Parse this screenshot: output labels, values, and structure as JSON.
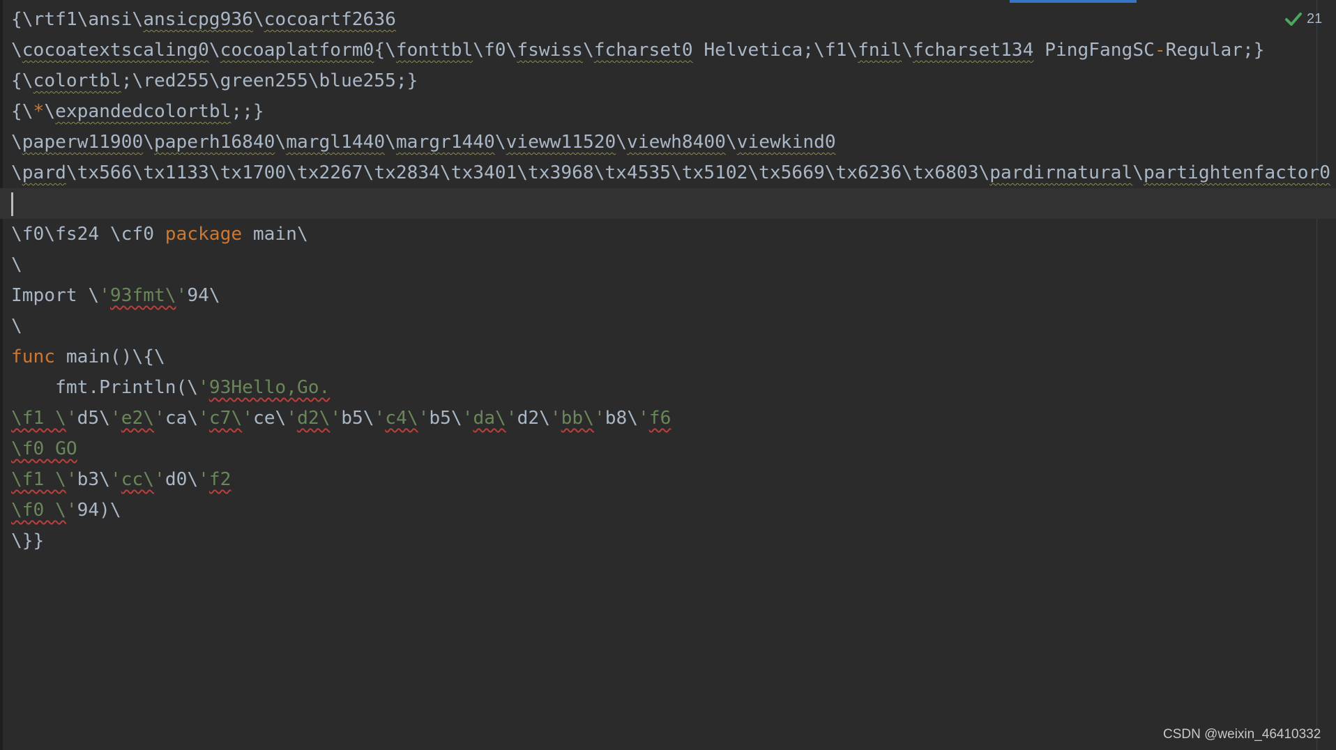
{
  "inspection": {
    "icon": "check-icon",
    "count": "21"
  },
  "editor": {
    "caret_line": 6,
    "lines": [
      {
        "tokens": [
          {
            "t": "{\\rtf1\\ansi\\",
            "c": "default"
          },
          {
            "t": "ansicpg936",
            "c": "default",
            "u": "typo"
          },
          {
            "t": "\\",
            "c": "default"
          },
          {
            "t": "cocoartf2636",
            "c": "default",
            "u": "typo"
          }
        ]
      },
      {
        "tokens": [
          {
            "t": "\\",
            "c": "default"
          },
          {
            "t": "cocoatextscaling0",
            "c": "default",
            "u": "typo"
          },
          {
            "t": "\\",
            "c": "default"
          },
          {
            "t": "cocoaplatform0",
            "c": "default",
            "u": "typo"
          },
          {
            "t": "{\\",
            "c": "default"
          },
          {
            "t": "fonttbl",
            "c": "default",
            "u": "typo"
          },
          {
            "t": "\\f0\\",
            "c": "default"
          },
          {
            "t": "fswiss",
            "c": "default",
            "u": "typo"
          },
          {
            "t": "\\",
            "c": "default"
          },
          {
            "t": "fcharset0",
            "c": "default",
            "u": "typo"
          },
          {
            "t": " Helvetica;\\f1\\",
            "c": "default"
          },
          {
            "t": "fnil",
            "c": "default",
            "u": "typo"
          },
          {
            "t": "\\",
            "c": "default"
          },
          {
            "t": "fcharset134",
            "c": "default",
            "u": "typo"
          },
          {
            "t": " PingFangSC",
            "c": "default"
          },
          {
            "t": "-",
            "c": "keyword"
          },
          {
            "t": "Regular;}",
            "c": "default"
          }
        ]
      },
      {
        "tokens": [
          {
            "t": "{\\",
            "c": "default"
          },
          {
            "t": "colortbl",
            "c": "default",
            "u": "typo"
          },
          {
            "t": ";\\red255\\green255\\blue255;}",
            "c": "default"
          }
        ]
      },
      {
        "tokens": [
          {
            "t": "{\\",
            "c": "default"
          },
          {
            "t": "*",
            "c": "keyword"
          },
          {
            "t": "\\",
            "c": "default"
          },
          {
            "t": "expandedcolortbl",
            "c": "default",
            "u": "typo"
          },
          {
            "t": ";;}",
            "c": "default"
          }
        ]
      },
      {
        "tokens": [
          {
            "t": "\\",
            "c": "default"
          },
          {
            "t": "paperw11900",
            "c": "default",
            "u": "typo"
          },
          {
            "t": "\\",
            "c": "default"
          },
          {
            "t": "paperh16840",
            "c": "default",
            "u": "typo"
          },
          {
            "t": "\\",
            "c": "default"
          },
          {
            "t": "margl1440",
            "c": "default",
            "u": "typo"
          },
          {
            "t": "\\",
            "c": "default"
          },
          {
            "t": "margr1440",
            "c": "default",
            "u": "typo"
          },
          {
            "t": "\\",
            "c": "default"
          },
          {
            "t": "vieww11520",
            "c": "default",
            "u": "typo"
          },
          {
            "t": "\\",
            "c": "default"
          },
          {
            "t": "viewh8400",
            "c": "default",
            "u": "typo"
          },
          {
            "t": "\\",
            "c": "default"
          },
          {
            "t": "viewkind0",
            "c": "default",
            "u": "typo"
          }
        ]
      },
      {
        "tokens": [
          {
            "t": "\\",
            "c": "default"
          },
          {
            "t": "pard",
            "c": "default",
            "u": "typo"
          },
          {
            "t": "\\tx566\\tx1133\\tx1700\\tx2267\\tx2834\\tx3401\\tx3968\\tx4535\\tx5102\\tx5669\\tx6236\\tx6803\\",
            "c": "default"
          },
          {
            "t": "pardirnatural",
            "c": "default",
            "u": "typo"
          },
          {
            "t": "\\",
            "c": "default"
          },
          {
            "t": "partightenfactor0",
            "c": "default",
            "u": "typo"
          }
        ]
      },
      {
        "tokens": []
      },
      {
        "tokens": [
          {
            "t": "\\f0\\fs24 \\cf0 ",
            "c": "default"
          },
          {
            "t": "package",
            "c": "keyword"
          },
          {
            "t": " main\\",
            "c": "default"
          }
        ]
      },
      {
        "tokens": [
          {
            "t": "\\",
            "c": "default"
          }
        ]
      },
      {
        "tokens": [
          {
            "t": "Import \\",
            "c": "default"
          },
          {
            "t": "'",
            "c": "string"
          },
          {
            "t": "93fmt\\",
            "c": "string",
            "u": "error"
          },
          {
            "t": "'",
            "c": "string"
          },
          {
            "t": "94\\",
            "c": "default"
          }
        ]
      },
      {
        "tokens": [
          {
            "t": "\\",
            "c": "default"
          }
        ]
      },
      {
        "tokens": [
          {
            "t": "func",
            "c": "keyword"
          },
          {
            "t": " main()\\{\\",
            "c": "default"
          }
        ]
      },
      {
        "tokens": [
          {
            "t": "    fmt.Println(\\",
            "c": "default"
          },
          {
            "t": "'",
            "c": "string"
          },
          {
            "t": "93Hello,Go.",
            "c": "string",
            "u": "error"
          }
        ]
      },
      {
        "tokens": [
          {
            "t": "\\f1 \\",
            "c": "string",
            "u": "error"
          },
          {
            "t": "'",
            "c": "string"
          },
          {
            "t": "d5\\",
            "c": "default"
          },
          {
            "t": "'",
            "c": "string"
          },
          {
            "t": "e2\\",
            "c": "string",
            "u": "error"
          },
          {
            "t": "'",
            "c": "string"
          },
          {
            "t": "ca\\",
            "c": "default"
          },
          {
            "t": "'",
            "c": "string"
          },
          {
            "t": "c7\\",
            "c": "string",
            "u": "error"
          },
          {
            "t": "'",
            "c": "string"
          },
          {
            "t": "ce\\",
            "c": "default"
          },
          {
            "t": "'",
            "c": "string"
          },
          {
            "t": "d2\\",
            "c": "string",
            "u": "error"
          },
          {
            "t": "'",
            "c": "string"
          },
          {
            "t": "b5\\",
            "c": "default"
          },
          {
            "t": "'",
            "c": "string"
          },
          {
            "t": "c4\\",
            "c": "string",
            "u": "error"
          },
          {
            "t": "'",
            "c": "string"
          },
          {
            "t": "b5\\",
            "c": "default"
          },
          {
            "t": "'",
            "c": "string"
          },
          {
            "t": "da\\",
            "c": "string",
            "u": "error"
          },
          {
            "t": "'",
            "c": "string"
          },
          {
            "t": "d2\\",
            "c": "default"
          },
          {
            "t": "'",
            "c": "string"
          },
          {
            "t": "bb\\",
            "c": "string",
            "u": "error"
          },
          {
            "t": "'",
            "c": "string"
          },
          {
            "t": "b8\\",
            "c": "default"
          },
          {
            "t": "'",
            "c": "string"
          },
          {
            "t": "f6",
            "c": "string",
            "u": "error"
          }
        ]
      },
      {
        "tokens": [
          {
            "t": "\\f0 GO",
            "c": "string",
            "u": "error"
          }
        ]
      },
      {
        "tokens": [
          {
            "t": "\\f1 \\",
            "c": "string",
            "u": "error"
          },
          {
            "t": "'",
            "c": "string"
          },
          {
            "t": "b3\\",
            "c": "default"
          },
          {
            "t": "'",
            "c": "string"
          },
          {
            "t": "cc\\",
            "c": "string",
            "u": "error"
          },
          {
            "t": "'",
            "c": "string"
          },
          {
            "t": "d0\\",
            "c": "default"
          },
          {
            "t": "'",
            "c": "string"
          },
          {
            "t": "f2",
            "c": "string",
            "u": "error"
          }
        ]
      },
      {
        "tokens": [
          {
            "t": "\\f0 \\",
            "c": "string",
            "u": "error"
          },
          {
            "t": "'",
            "c": "string"
          },
          {
            "t": "94)\\",
            "c": "default"
          }
        ]
      },
      {
        "tokens": [
          {
            "t": "\\}}",
            "c": "default"
          }
        ]
      }
    ]
  },
  "watermark": "CSDN @weixin_46410332",
  "colors": {
    "background": "#2b2b2b",
    "text": "#a9b7c6",
    "keyword": "#cc7832",
    "string": "#6a8759",
    "error_underline": "#bc3f3c",
    "typo_underline": "#8e8e3a",
    "check": "#4ca85b",
    "scroll_indicator": "#3574c6"
  }
}
